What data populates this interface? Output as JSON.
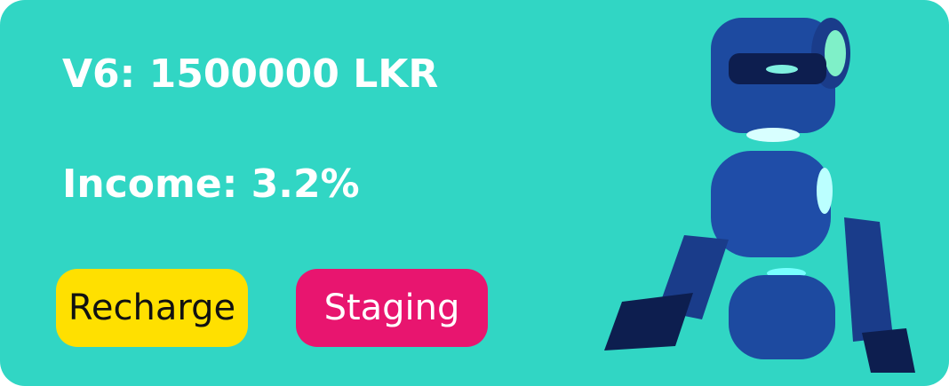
{
  "card": {
    "title": "V6: 1500000 LKR",
    "income": "Income: 3.2%",
    "buttons": {
      "recharge": "Recharge",
      "staging": "Staging"
    },
    "colors": {
      "background": "#31d6c4",
      "recharge": "#ffe000",
      "staging": "#e8156f"
    },
    "illustration": "robot-icon"
  }
}
